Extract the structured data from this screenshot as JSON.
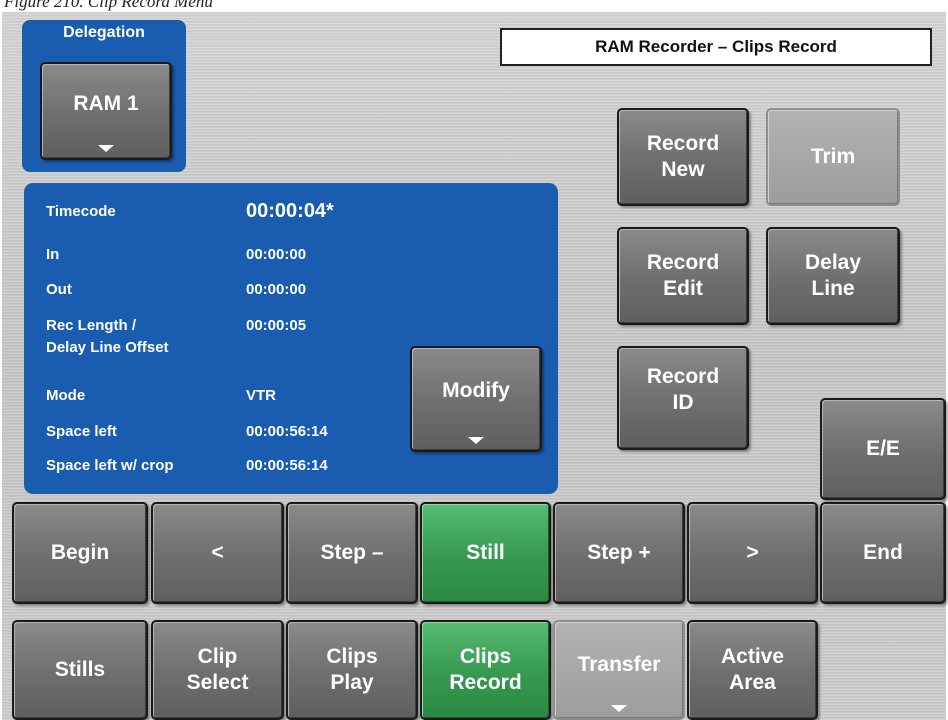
{
  "caption": "Figure 210. Clip Record Menu",
  "menu_title": "RAM Recorder – Clips Record",
  "delegation": {
    "title": "Delegation",
    "button": "RAM 1"
  },
  "info": {
    "timecode": {
      "label": "Timecode",
      "value": "00:00:04*"
    },
    "in": {
      "label": "In",
      "value": "00:00:00"
    },
    "out": {
      "label": "Out",
      "value": "00:00:00"
    },
    "rec_length": {
      "label": "Rec Length /",
      "label2": "Delay Line Offset",
      "value": "00:00:05"
    },
    "mode": {
      "label": "Mode",
      "value": "VTR"
    },
    "space_left": {
      "label": "Space left",
      "value": "00:00:56:14"
    },
    "space_left_crop": {
      "label": "Space left w/ crop",
      "value": "00:00:56:14"
    }
  },
  "buttons": {
    "modify": "Modify",
    "record_new": "Record\nNew",
    "trim": "Trim",
    "record_edit": "Record\nEdit",
    "delay_line": "Delay\nLine",
    "record_id": "Record\nID",
    "ee": "E/E"
  },
  "transport": {
    "begin": "Begin",
    "back": "<",
    "step_minus": "Step –",
    "still": "Still",
    "step_plus": "Step +",
    "forward": ">",
    "end": "End"
  },
  "menus": {
    "stills": "Stills",
    "clip_select": "Clip\nSelect",
    "clips_play": "Clips\nPlay",
    "clips_record": "Clips\nRecord",
    "transfer": "Transfer",
    "active_area": "Active\nArea"
  },
  "colors": {
    "blue_panel": "#1a5cb0",
    "active_green": "#36994f",
    "button_gray": "#6e6e6e"
  }
}
